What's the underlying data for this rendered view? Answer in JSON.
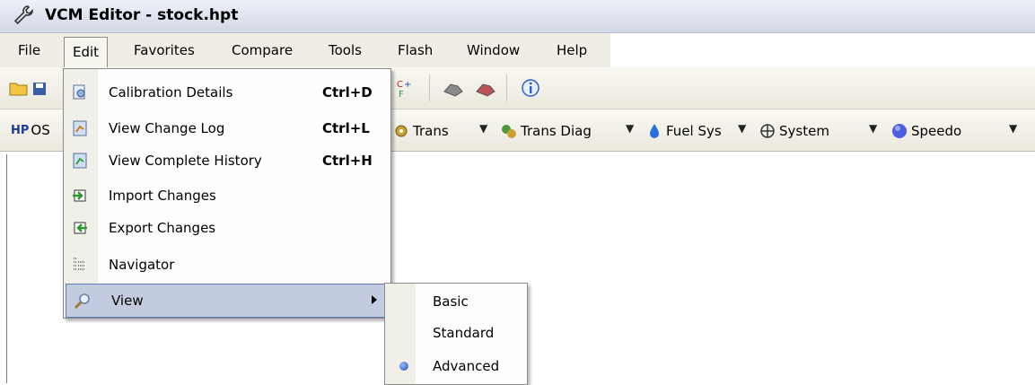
{
  "window": {
    "title": "VCM Editor - stock.hpt",
    "app_icon": "wrench-icon"
  },
  "menubar": {
    "items": [
      {
        "label": "File"
      },
      {
        "label": "Edit",
        "active": true
      },
      {
        "label": "Favorites"
      },
      {
        "label": "Compare"
      },
      {
        "label": "Tools"
      },
      {
        "label": "Flash"
      },
      {
        "label": "Window"
      },
      {
        "label": "Help"
      }
    ]
  },
  "toolbar1": {
    "icons": [
      "open-folder-icon",
      "save-icon",
      "compare-cf-icon",
      "read-vehicle-icon",
      "write-vehicle-icon",
      "info-icon"
    ]
  },
  "toolbar2": {
    "items": [
      {
        "label": "OS",
        "icon": "hp-logo-icon"
      },
      {
        "label": "Trans",
        "icon": "gear-trans-icon"
      },
      {
        "label": "Trans Diag",
        "icon": "trans-diag-icon"
      },
      {
        "label": "Fuel Sys",
        "icon": "fuel-drop-icon"
      },
      {
        "label": "System",
        "icon": "system-fan-icon"
      },
      {
        "label": "Speedo",
        "icon": "speedo-icon"
      }
    ]
  },
  "edit_menu": {
    "items": [
      {
        "label": "Calibration Details",
        "shortcut": "Ctrl+D",
        "icon": "calibration-details-icon"
      },
      {
        "label": "View Change Log",
        "shortcut": "Ctrl+L",
        "icon": "change-log-icon"
      },
      {
        "label": "View Complete History",
        "shortcut": "Ctrl+H",
        "icon": "history-icon"
      },
      {
        "label": "Import Changes",
        "shortcut": "",
        "icon": "import-icon"
      },
      {
        "label": "Export Changes",
        "shortcut": "",
        "icon": "export-icon"
      },
      {
        "label": "Navigator",
        "shortcut": "",
        "icon": "navigator-icon"
      },
      {
        "label": "View",
        "shortcut": "",
        "icon": "magnifier-icon",
        "highlighted": true,
        "has_submenu": true
      }
    ]
  },
  "view_submenu": {
    "items": [
      {
        "label": "Basic",
        "selected": false
      },
      {
        "label": "Standard",
        "selected": false
      },
      {
        "label": "Advanced",
        "selected": true
      }
    ]
  },
  "colors": {
    "highlight": "#c2cbe0",
    "menubar": "#f0eee4",
    "bullet": "#1f4fb8"
  }
}
